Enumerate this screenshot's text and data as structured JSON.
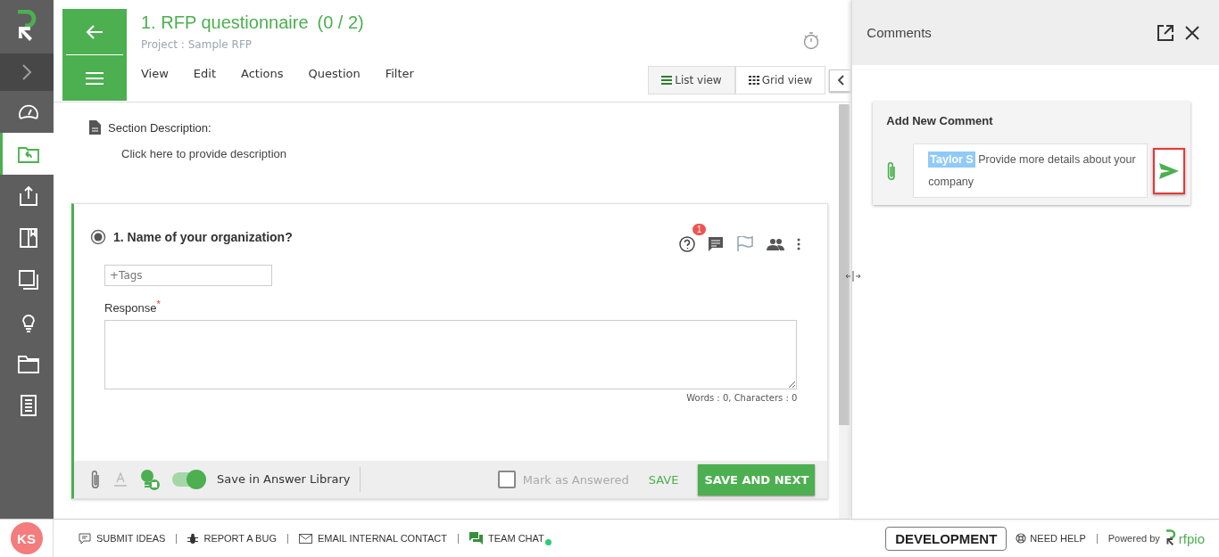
{
  "sidebar": {
    "items": [
      {
        "kind": "dashboard",
        "selected": false
      },
      {
        "kind": "projects",
        "selected": true
      },
      {
        "kind": "export",
        "selected": false
      },
      {
        "kind": "book",
        "selected": false
      },
      {
        "kind": "windows",
        "selected": false
      },
      {
        "kind": "bulb",
        "selected": false
      },
      {
        "kind": "folder",
        "selected": false
      },
      {
        "kind": "list",
        "selected": false
      }
    ]
  },
  "header": {
    "title": "1. RFP questionnaire",
    "count": "(0 / 2)",
    "project": "Project : Sample RFP",
    "menu": [
      "View",
      "Edit",
      "Actions",
      "Question",
      "Filter"
    ],
    "views": [
      {
        "label": "List view",
        "kind": "list",
        "selected": true
      },
      {
        "label": "Grid view",
        "kind": "grid",
        "selected": false
      }
    ]
  },
  "section": {
    "label": "Section Description:",
    "placeholder": "Click here to provide description"
  },
  "question": {
    "title": "1. Name of your organization?",
    "selected": true,
    "badge": "1",
    "tags_placeholder": "+Tags",
    "response_label": "Response",
    "required_mark": "*",
    "counter": "Words : 0, Characters : 0"
  },
  "answer_bar": {
    "library_toggle": {
      "label": "Save in Answer Library",
      "on": true
    },
    "mark_answered": {
      "label": "Mark as Answered",
      "checked": false
    },
    "save": "SAVE",
    "save_next": "SAVE AND NEXT"
  },
  "comments": {
    "title": "Comments",
    "card_title": "Add New Comment",
    "mention": "Taylor S",
    "text": "Provide more details about your company"
  },
  "status_bar": {
    "avatar": "KS",
    "links": [
      {
        "kind": "ideas",
        "label": "SUBMIT IDEAS"
      },
      {
        "kind": "bug",
        "label": "REPORT A BUG"
      },
      {
        "kind": "email",
        "label": "EMAIL INTERNAL CONTACT"
      },
      {
        "kind": "chat",
        "label": "TEAM CHAT",
        "online": true
      }
    ],
    "environment": "DEVELOPMENT",
    "help": "NEED HELP",
    "powered": "Powered by",
    "brand": "rfpio"
  }
}
